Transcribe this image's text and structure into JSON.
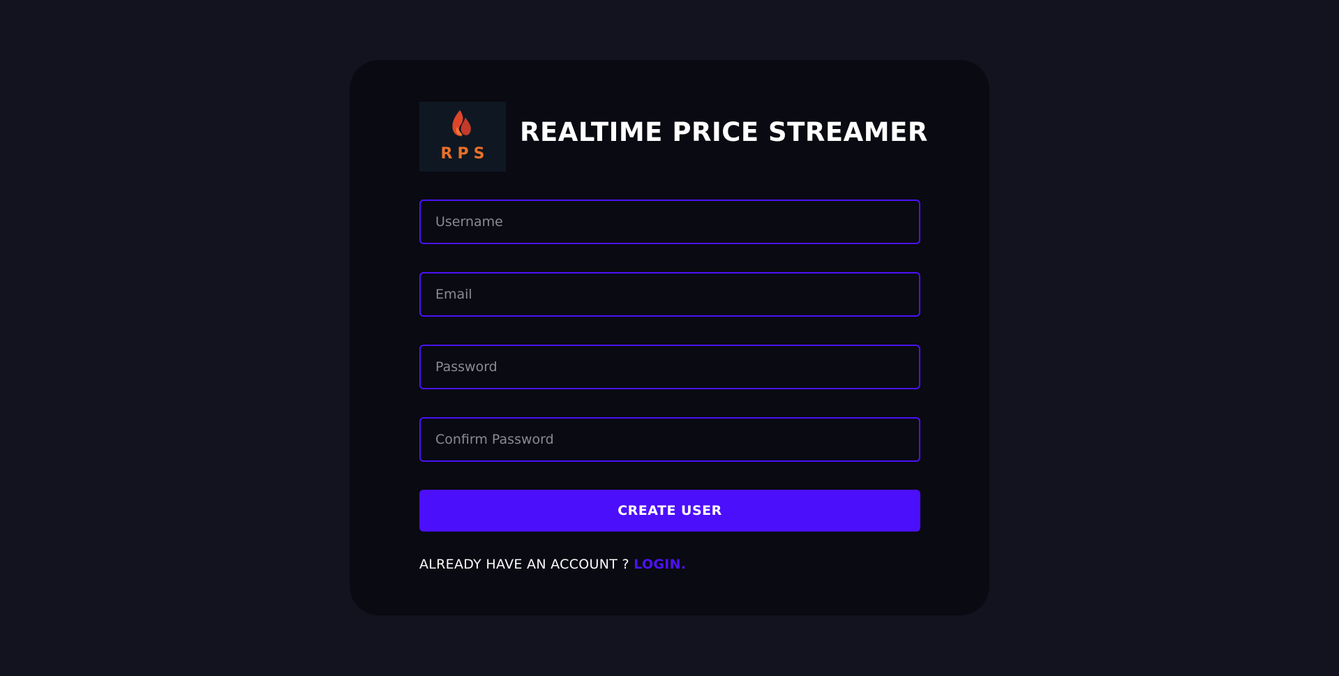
{
  "brand": {
    "logo_text": "RPS",
    "logo_icon": "flame-icon",
    "title": "REALTIME PRICE STREAMER"
  },
  "form": {
    "username_placeholder": "Username",
    "email_placeholder": "Email",
    "password_placeholder": "Password",
    "confirm_password_placeholder": "Confirm Password",
    "submit_label": "CREATE USER"
  },
  "footer": {
    "prompt": "ALREADY HAVE AN ACCOUNT ?",
    "login_label": "LOGIN."
  },
  "colors": {
    "page_background": "#13131f",
    "card_background": "#0a0a12",
    "accent": "#4c0ffb",
    "logo_orange": "#e8702a"
  }
}
